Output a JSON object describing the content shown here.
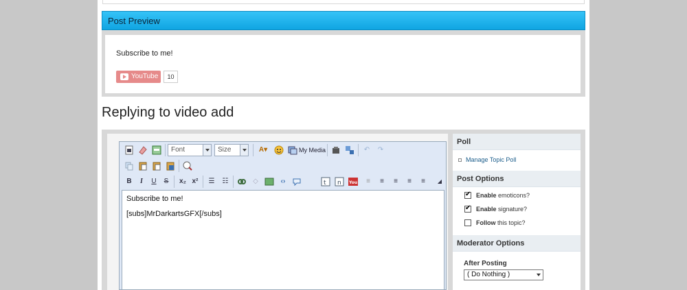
{
  "preview": {
    "header": "Post Preview",
    "text": "Subscribe to me!",
    "youtube_label": "YouTube",
    "youtube_count": "10",
    "youtube_color": "#e68a8a"
  },
  "reply": {
    "title": "Replying to video add"
  },
  "editor": {
    "font_combo": "Font",
    "size_combo": "Size",
    "my_media_label": "My Media",
    "content_line1": "Subscribe to me!",
    "content_line2": "[subs]MrDarkartsGFX[/subs]",
    "toolbar_row1_icons": [
      "source-icon",
      "eraser-icon",
      "paste-text-icon",
      "font-color-icon",
      "emoticon-icon",
      "my-media-icon",
      "special-char-icon",
      "share-icon",
      "undo-icon",
      "redo-icon"
    ],
    "toolbar_row2_icons": [
      "copy-icon",
      "paste-icon",
      "paste-plain-icon",
      "paste-word-icon",
      "spellcheck-icon"
    ],
    "toolbar_row3_icons": [
      "bold-icon",
      "italic-icon",
      "underline-icon",
      "strike-icon",
      "subscript-icon",
      "superscript-icon",
      "bullet-list-icon",
      "number-list-icon",
      "link-icon",
      "unlink-icon",
      "image-icon",
      "code-icon",
      "quote-icon",
      "twitter-icon",
      "linkedin-icon",
      "youtube-icon",
      "align-left-icon",
      "align-center-icon",
      "align-justify-icon",
      "align-right-icon",
      "indent-icon",
      "resize-icon"
    ]
  },
  "sidebar": {
    "poll_heading": "Poll",
    "manage_poll": "Manage Topic Poll",
    "post_options_heading": "Post Options",
    "options": [
      {
        "bold": "Enable",
        "rest": " emoticons?",
        "checked": true
      },
      {
        "bold": "Enable",
        "rest": " signature?",
        "checked": true
      },
      {
        "bold": "Follow",
        "rest": " this topic?",
        "checked": false
      }
    ],
    "moderator_heading": "Moderator Options",
    "after_posting_label": "After Posting",
    "after_posting_value": "( Do Nothing )"
  },
  "colors": {
    "header_gradient_top": "#35c3f7",
    "header_gradient_bottom": "#10a5e2",
    "link": "#1a5c8a"
  }
}
